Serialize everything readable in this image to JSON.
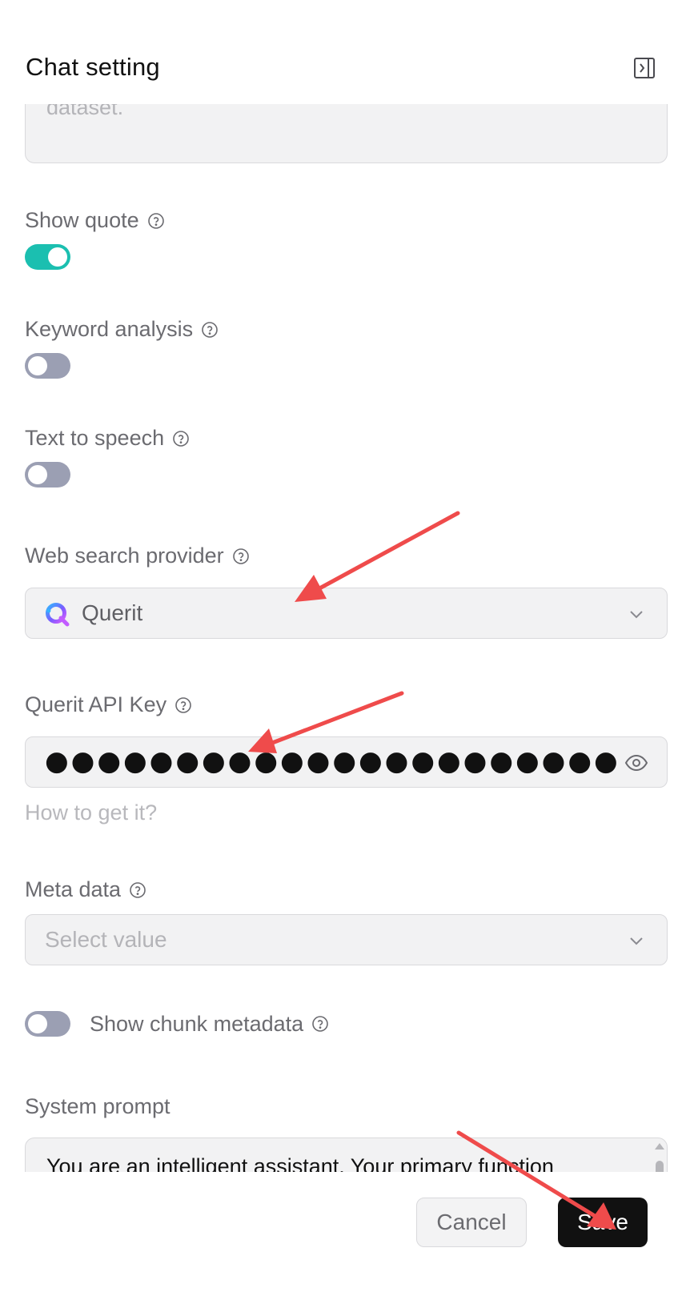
{
  "header": {
    "title": "Chat setting",
    "collapse_icon": "sidebar-collapse-icon"
  },
  "previous_field": {
    "placeholder_fragment": "dataset."
  },
  "show_quote": {
    "label": "Show quote",
    "enabled": true
  },
  "keyword_analysis": {
    "label": "Keyword analysis",
    "enabled": false
  },
  "text_to_speech": {
    "label": "Text to speech",
    "enabled": false
  },
  "web_search_provider": {
    "label": "Web search provider",
    "selected": "Querit",
    "logo_icon": "querit-logo-icon"
  },
  "api_key": {
    "label": "Querit API Key",
    "masked_value": "●●●●●●●●●●●●●●●●●●●●●●●●●●●●●●●●●●●●●●●●●●●",
    "help_link": "How to get it?",
    "reveal_icon": "eye-icon"
  },
  "meta_data": {
    "label": "Meta data",
    "placeholder": "Select value"
  },
  "show_chunk_metadata": {
    "label": "Show chunk metadata",
    "enabled": false
  },
  "system_prompt": {
    "label": "System prompt",
    "value": "You are an intelligent assistant. Your primary function"
  },
  "footer": {
    "cancel_label": "Cancel",
    "save_label": "Save"
  },
  "colors": {
    "toggle_on": "#1bbfb0",
    "toggle_off": "#9b9fb3",
    "annotation_arrow": "#ef4b4b",
    "primary_button": "#111111"
  }
}
